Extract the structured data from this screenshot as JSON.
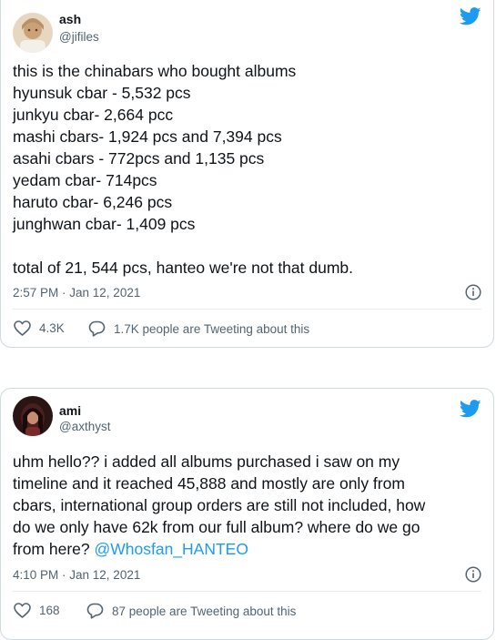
{
  "tweets": [
    {
      "display_name": "ash",
      "handle": "@jifiles",
      "body_lines": [
        "this is the chinabars who bought albums",
        "hyunsuk cbar - 5,532 pcs",
        "junkyu cbar- 2,664 pcc",
        "mashi cbars- 1,924 pcs and 7,394 pcs",
        "asahi cbars - 772pcs and 1,135 pcs",
        "yedam cbar- 714pcs",
        "haruto cbar- 6,246 pcs",
        "junghwan cbar- 1,409 pcs",
        "",
        "total of 21, 544 pcs, hanteo we're not that dumb."
      ],
      "timestamp": "2:57 PM · Jan 12, 2021",
      "like_count": "4.3K",
      "conversation_text": "1.7K people are Tweeting about this"
    },
    {
      "display_name": "ami",
      "handle": "@axthyst",
      "body_lines": [
        "uhm hello?? i added all albums purchased i saw on my",
        "timeline and it reached 45,888 and mostly are only from",
        "cbars, international group orders are still not included, how",
        "do we only have 62k from our full album? where do we go"
      ],
      "body_last_text": "from here? ",
      "mention": "@Whosfan_HANTEO",
      "timestamp": "4:10 PM · Jan 12, 2021",
      "like_count": "168",
      "conversation_text": "87 people are Tweeting about this"
    }
  ],
  "colors": {
    "accent": "#1d9bf0",
    "text": "#0f1419",
    "secondary": "#536471",
    "border": "#cfd9de"
  },
  "icons": [
    "twitter-bird-icon",
    "info-icon",
    "heart-icon",
    "reply-bubble-icon"
  ]
}
